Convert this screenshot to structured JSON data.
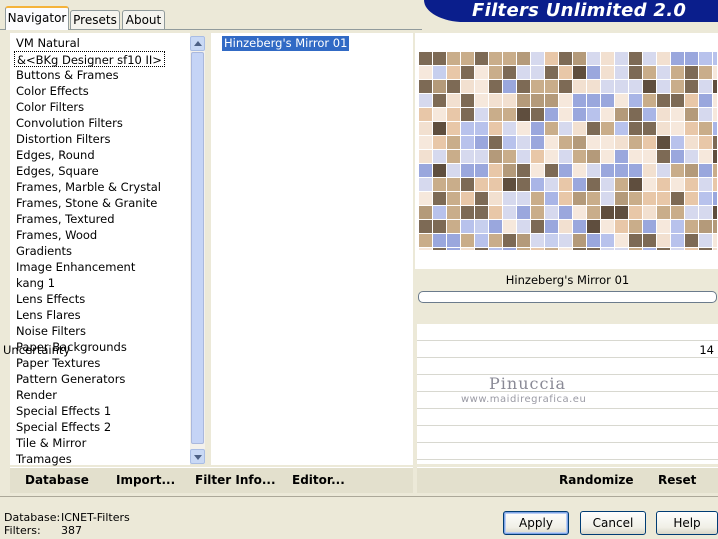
{
  "tabs": [
    {
      "label": "Navigator",
      "active": true
    },
    {
      "label": "Presets",
      "active": false
    },
    {
      "label": "About",
      "active": false
    }
  ],
  "app_title": "Filters Unlimited 2.0",
  "categories": [
    "VM Natural",
    "&<BKg Designer sf10 II>",
    "Buttons & Frames",
    "Color Effects",
    "Color Filters",
    "Convolution Filters",
    "Distortion Filters",
    "Edges, Round",
    "Edges, Square",
    "Frames, Marble & Crystal",
    "Frames, Stone & Granite",
    "Frames, Textured",
    "Frames, Wood",
    "Gradients",
    "Image Enhancement",
    "kang 1",
    "Lens Effects",
    "Lens Flares",
    "Noise Filters",
    "Paper Backgrounds",
    "Paper Textures",
    "Pattern Generators",
    "Render",
    "Special Effects 1",
    "Special Effects 2",
    "Tile & Mirror",
    "Tramages"
  ],
  "selected_category_index": 1,
  "filters": [
    "Hinzeberg's Mirror 01"
  ],
  "preview": {
    "filter_name": "Hinzeberg's Mirror 01"
  },
  "params": [
    {
      "label": "Uncertainty",
      "value": "14"
    }
  ],
  "watermark": {
    "line1": "Pinuccia",
    "line2": "www.maidiregrafica.eu"
  },
  "bottom_left_buttons": {
    "database": "Database",
    "import": "Import...",
    "filter_info": "Filter Info...",
    "editor": "Editor..."
  },
  "bottom_right_buttons": {
    "randomize": "Randomize",
    "reset": "Reset"
  },
  "status": {
    "database_label": "Database:",
    "database_value": "ICNET-Filters",
    "filters_label": "Filters:",
    "filters_value": "387"
  },
  "dialog_buttons": {
    "apply": "Apply",
    "cancel": "Cancel",
    "help": "Help"
  },
  "colors": {
    "selection": "#316ac5",
    "banner": "#0a1e8c",
    "dialog_bg": "#ece9d8"
  }
}
